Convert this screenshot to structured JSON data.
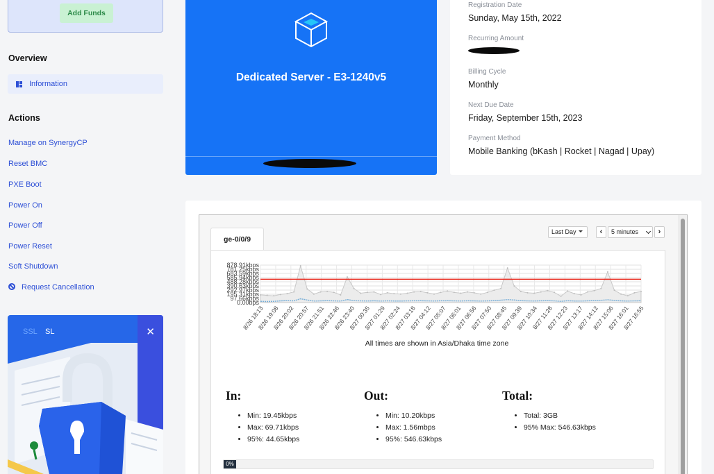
{
  "sidebar": {
    "add_funds_label": "Add Funds",
    "overview_title": "Overview",
    "information_label": "Information",
    "actions_title": "Actions",
    "actions": [
      "Manage on SynergyCP",
      "Reset BMC",
      "PXE Boot",
      "Power On",
      "Power Off",
      "Power Reset",
      "Soft Shutdown",
      "Request Cancellation"
    ],
    "promo": {
      "ssl": "SSL",
      "sl": "SL",
      "close": "✕"
    }
  },
  "server": {
    "icon": "cube-icon",
    "title": "Dedicated Server - E3-1240v5"
  },
  "details": {
    "registration_label": "Registration Date",
    "registration_value": "Sunday, May 15th, 2022",
    "recurring_label": "Recurring Amount",
    "billing_label": "Billing Cycle",
    "billing_value": "Monthly",
    "next_due_label": "Next Due Date",
    "next_due_value": "Friday, September 15th, 2023",
    "payment_label": "Payment Method",
    "payment_value": "Mobile Banking (bKash | Rocket | Nagad | Upay)"
  },
  "graph": {
    "interface_tab": "ge-0/0/9",
    "period_value": "Last Day",
    "interval_value": "5 minutes",
    "prev": "‹",
    "next": "›",
    "timezone_note": "All times are shown in Asia/Dhaka time zone",
    "progress_percent": 0,
    "progress_label": "0%",
    "colors": {
      "line_95": "#e8281c",
      "traffic": "#c8c8c8",
      "out": "#7ab0d8"
    }
  },
  "stats": {
    "in": {
      "title": "In:",
      "items": [
        "Min: 19.45kbps",
        "Max: 69.71kbps",
        "95%: 44.65kbps"
      ]
    },
    "out": {
      "title": "Out:",
      "items": [
        "Min: 10.20kbps",
        "Max: 1.56mbps",
        "95%: 546.63kbps"
      ]
    },
    "total": {
      "title": "Total:",
      "items": [
        "Total: 3GB",
        "95% Max: 546.63kbps"
      ]
    }
  },
  "chart_data": {
    "type": "line",
    "ylabels": [
      "878.91kbps",
      "781.25kbps",
      "683.59kbps",
      "585.94kbps",
      "488.28kbps",
      "390.63kbps",
      "292.97kbps",
      "195.31kbps",
      "97.66kbps",
      "0.00bps"
    ],
    "ylim": [
      0,
      878.91
    ],
    "y_unit": "kbps",
    "categories": [
      "8/26 18:13",
      "8/26 19:08",
      "8/26 20:02",
      "8/26 20:57",
      "8/26 21:51",
      "8/26 22:46",
      "8/26 23:40",
      "8/27 00:35",
      "8/27 01:29",
      "8/27 02:24",
      "8/27 03:18",
      "8/27 04:12",
      "8/27 05:07",
      "8/27 06:01",
      "8/27 06:56",
      "8/27 07:50",
      "8/27 08:45",
      "8/27 09:39",
      "8/27 10:34",
      "8/27 11:28",
      "8/27 12:23",
      "8/27 13:17",
      "8/27 14:12",
      "8/27 15:06",
      "8/27 16:01",
      "8/27 16:55"
    ],
    "series": [
      {
        "values": [
          180,
          170,
          160,
          190,
          210,
          250,
          860,
          320,
          200,
          250,
          260,
          240,
          180,
          600,
          330,
          220,
          240,
          250,
          190,
          230,
          210,
          200,
          220,
          250,
          260,
          230,
          200,
          240,
          270,
          240,
          220,
          250,
          230,
          200,
          240,
          290,
          330,
          810,
          390,
          260,
          230,
          220,
          250,
          280,
          240,
          150,
          270,
          210,
          180,
          250,
          280,
          330,
          720,
          290,
          200,
          160,
          230,
          260
        ]
      },
      {
        "values": [
          30,
          25,
          30,
          40,
          45,
          40,
          90,
          60,
          35,
          40,
          45,
          40,
          35,
          70,
          45,
          40,
          38,
          42,
          35,
          40,
          38,
          36,
          40,
          42,
          44,
          40,
          38,
          42,
          44,
          40,
          38,
          42,
          40,
          36,
          40,
          45,
          55,
          70,
          60,
          45,
          40,
          38,
          42,
          46,
          40,
          30,
          44,
          38,
          35,
          42,
          46,
          52,
          65,
          50,
          40,
          35,
          40,
          42
        ]
      }
    ],
    "reference_95th": 546.63,
    "grid": true
  }
}
